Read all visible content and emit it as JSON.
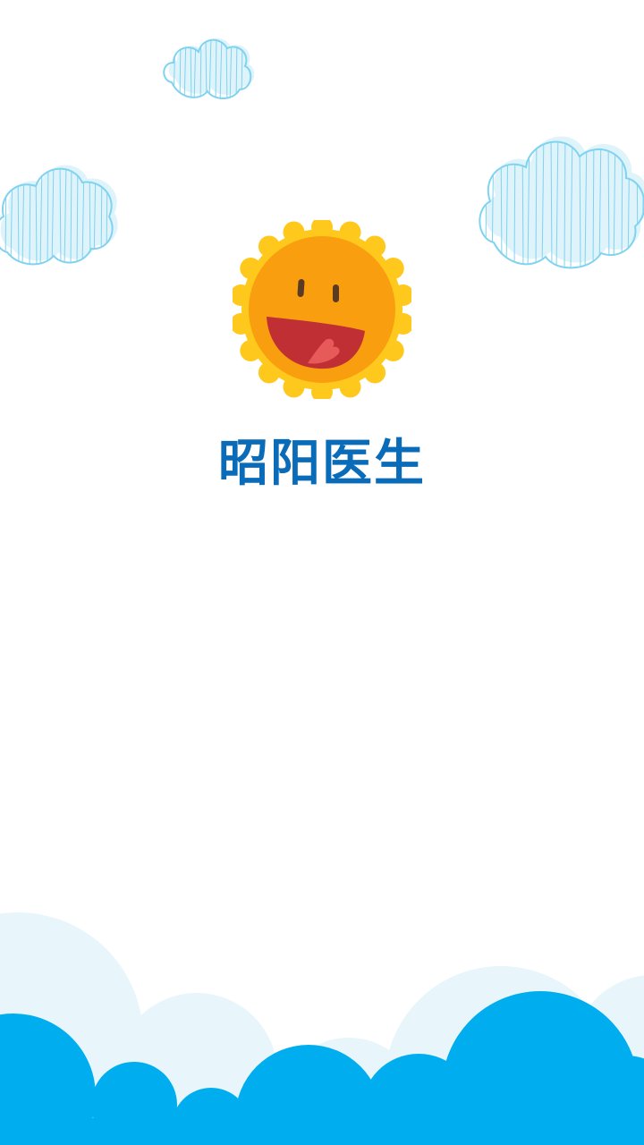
{
  "app": {
    "title": "昭阳医生"
  },
  "colors": {
    "title_blue": "#0a6bb8",
    "sky_blue": "#00aeef",
    "pale_blue": "#e8f6fc",
    "cloud_stroke": "#7fd3f0",
    "sun_outer": "#ffc81c",
    "sun_inner": "#f99e0e",
    "mouth": "#bf2f33",
    "tongue": "#e75a5a"
  },
  "icons": {
    "logo": "smiling-sun-icon",
    "decor": "sketched-cloud-icon"
  }
}
